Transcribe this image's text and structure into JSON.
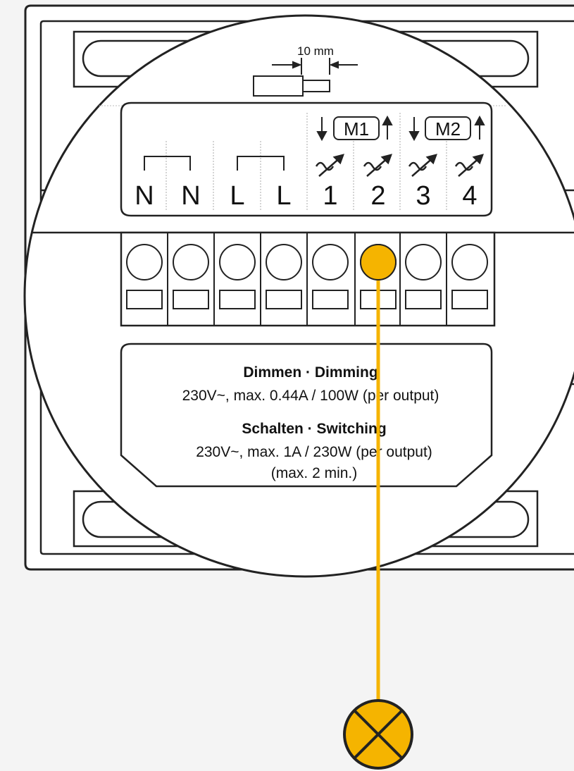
{
  "strip": {
    "dimension": "10 mm"
  },
  "motors": [
    {
      "label": "M1"
    },
    {
      "label": "M2"
    }
  ],
  "terminals": [
    {
      "label": "N"
    },
    {
      "label": "N"
    },
    {
      "label": "L"
    },
    {
      "label": "L"
    },
    {
      "label": "1"
    },
    {
      "label": "2"
    },
    {
      "label": "3"
    },
    {
      "label": "4"
    }
  ],
  "connected_terminal": "2",
  "ratings": {
    "dimming_title": "Dimmen · Dimming",
    "dimming_spec": "230V~, max. 0.44A / 100W (per output)",
    "switching_title": "Schalten · Switching",
    "switching_spec": "230V~, max. 1A / 230W (per output)",
    "switching_limit": "(max. 2 min.)"
  },
  "colors": {
    "wire": "#f5b400",
    "line": "#222222",
    "background": "#f4f4f4"
  },
  "icons": {
    "lamp": "lamp-icon",
    "dimmable_output": "dimmer-icon",
    "arrow_down": "arrow-down-icon",
    "arrow_up": "arrow-up-icon"
  }
}
